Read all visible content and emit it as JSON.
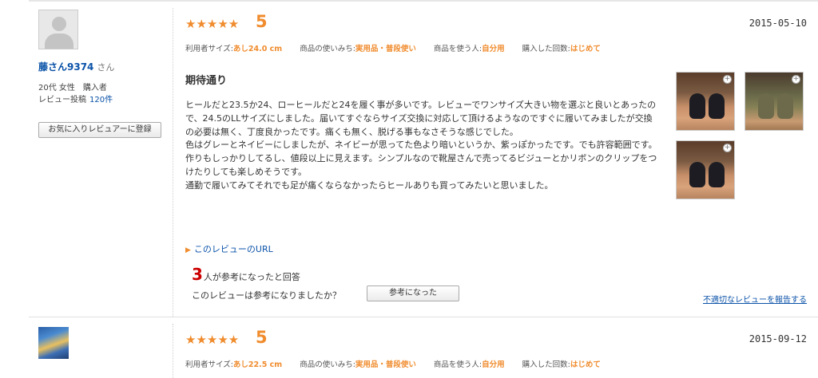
{
  "reviews": [
    {
      "user": {
        "name": "藤さん9374",
        "suffix": "さん",
        "demographic": "20代 女性　購入者",
        "post_label": "レビュー投稿",
        "post_count": "120件",
        "fav_button": "お気に入りレビュアーに登録"
      },
      "stars": "★★★★★",
      "score": "5",
      "date": "2015-05-10",
      "attrs": {
        "size_label": "利用者サイズ:",
        "size_value": "あし24.0 cm",
        "usage_label": "商品の使いみち:",
        "usage_value": "実用品・普段使い",
        "user_label": "商品を使う人:",
        "user_value": "自分用",
        "times_label": "購入した回数:",
        "times_value": "はじめて"
      },
      "title": "期待通り",
      "body": "ヒールだと23.5か24、ローヒールだと24を履く事が多いです。レビューでワンサイズ大きい物を選ぶと良いとあったので、24.5のLLサイズにしました。届いてすぐならサイズ交換に対応して頂けるようなのですぐに履いてみましたが交換の必要は無く、丁度良かったです。痛くも無く、脱げる事もなさそうな感じでした。\n色はグレーとネイビーにしましたが、ネイビーが思ってた色より暗いというか、紫っぽかったです。でも許容範囲です。\n作りもしっかりしてるし、値段以上に見えます。シンプルなので靴屋さんで売ってるビジューとかリボンのクリップをつけたりしても楽しめそうです。\n通勤で履いてみてそれでも足が痛くならなかったらヒールありも買ってみたいと思いました。",
      "url_label": "このレビューのURL",
      "helpful_count": "3",
      "helpful_text": "人が参考になったと回答",
      "ask_text": "このレビューは参考になりましたか？",
      "helpful_button": "参考になった",
      "report_link": "不適切なレビューを報告する"
    },
    {
      "stars": "★★★★★",
      "score": "5",
      "date": "2015-09-12",
      "attrs": {
        "size_label": "利用者サイズ:",
        "size_value": "あし22.5 cm",
        "usage_label": "商品の使いみち:",
        "usage_value": "実用品・普段使い",
        "user_label": "商品を使う人:",
        "user_value": "自分用",
        "times_label": "購入した回数:",
        "times_value": "はじめて"
      }
    }
  ],
  "icons": {
    "zoom": "zoom-plus-icon",
    "avatar_default": "default-avatar-icon",
    "bullet": "triangle-bullet-icon"
  },
  "colors": {
    "accent": "#f08c2e",
    "link": "#0a52a8",
    "count": "#cc0000"
  }
}
